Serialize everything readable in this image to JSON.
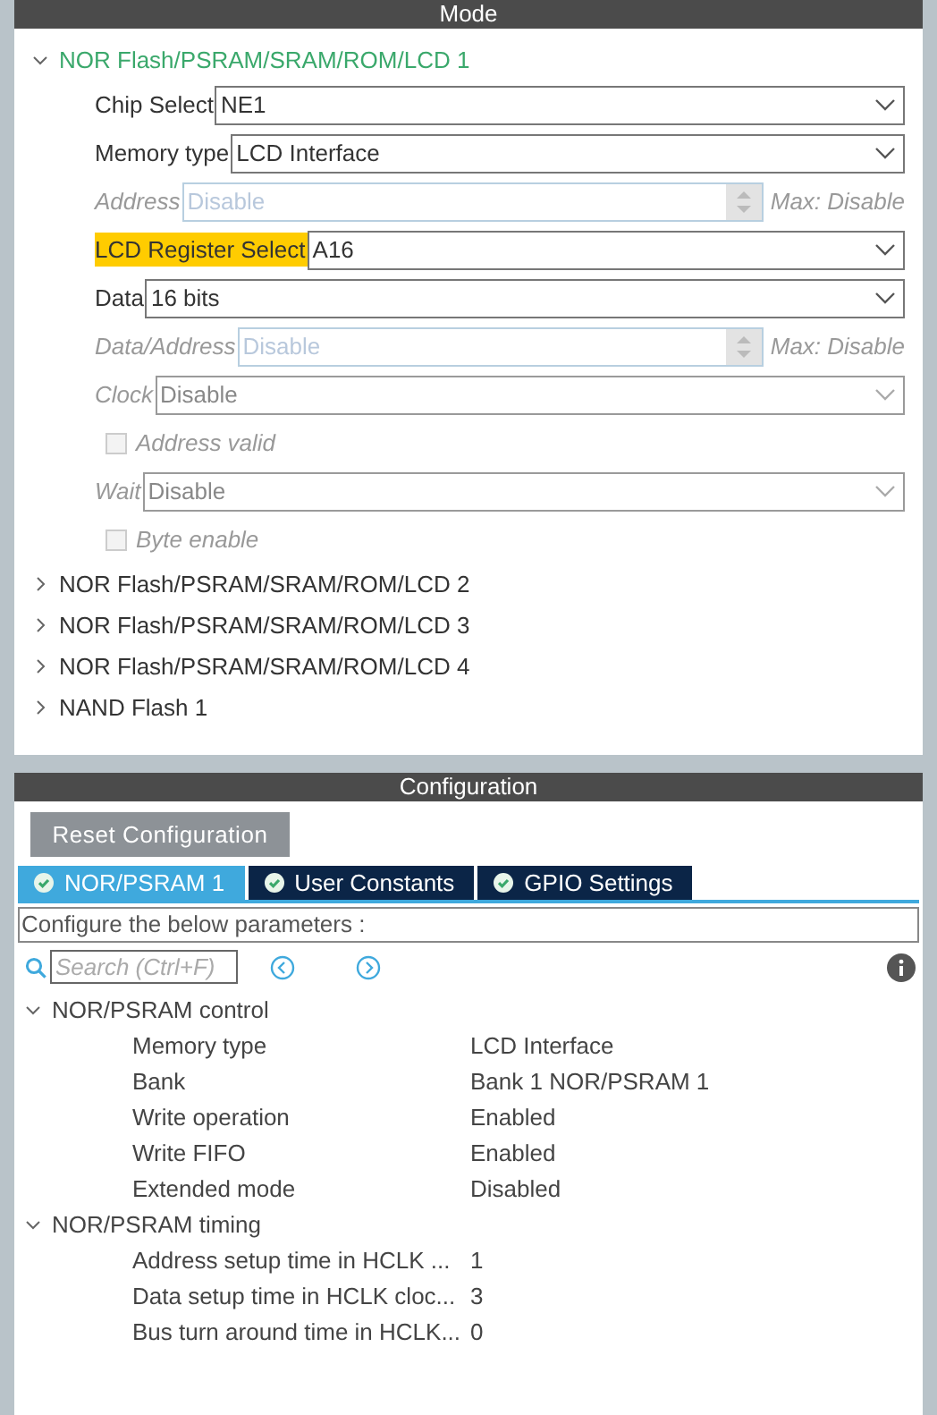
{
  "mode": {
    "title": "Mode",
    "sections": [
      {
        "label": "NOR Flash/PSRAM/SRAM/ROM/LCD 1",
        "expanded": true,
        "active": true,
        "fields": [
          {
            "kind": "select",
            "label": "Chip Select",
            "value": "NE1",
            "disabled": false,
            "highlighted": false
          },
          {
            "kind": "select",
            "label": "Memory type",
            "value": "LCD Interface",
            "disabled": false,
            "highlighted": false
          },
          {
            "kind": "spinner",
            "label": "Address",
            "value": "Disable",
            "max": "Max: Disable",
            "disabled": true,
            "highlighted": false
          },
          {
            "kind": "select",
            "label": "LCD Register Select",
            "value": "A16",
            "disabled": false,
            "highlighted": true
          },
          {
            "kind": "select",
            "label": "Data",
            "value": "16 bits",
            "disabled": false,
            "highlighted": false
          },
          {
            "kind": "spinner",
            "label": "Data/Address",
            "value": "Disable",
            "max": "Max: Disable",
            "disabled": true,
            "highlighted": false
          },
          {
            "kind": "select",
            "label": "Clock",
            "value": "Disable",
            "disabled": true,
            "highlighted": false
          },
          {
            "kind": "checkbox",
            "label": "Address valid",
            "checked": false,
            "disabled": true
          },
          {
            "kind": "select",
            "label": "Wait",
            "value": "Disable",
            "disabled": true,
            "highlighted": false
          },
          {
            "kind": "checkbox",
            "label": "Byte enable",
            "checked": false,
            "disabled": true
          }
        ]
      },
      {
        "label": "NOR Flash/PSRAM/SRAM/ROM/LCD 2",
        "expanded": false,
        "active": false
      },
      {
        "label": "NOR Flash/PSRAM/SRAM/ROM/LCD 3",
        "expanded": false,
        "active": false
      },
      {
        "label": "NOR Flash/PSRAM/SRAM/ROM/LCD 4",
        "expanded": false,
        "active": false
      },
      {
        "label": "NAND Flash 1",
        "expanded": false,
        "active": false
      }
    ]
  },
  "configuration": {
    "title": "Configuration",
    "reset_button": "Reset Configuration",
    "tabs": [
      {
        "label": "NOR/PSRAM 1",
        "selected": true
      },
      {
        "label": "User Constants",
        "selected": false
      },
      {
        "label": "GPIO Settings",
        "selected": false
      }
    ],
    "description": "Configure the below parameters :",
    "search": {
      "placeholder": "Search (Ctrl+F)"
    },
    "groups": [
      {
        "label": "NOR/PSRAM control",
        "expanded": true,
        "params": [
          {
            "name": "Memory type",
            "value": "LCD Interface"
          },
          {
            "name": "Bank",
            "value": "Bank 1 NOR/PSRAM 1"
          },
          {
            "name": "Write operation",
            "value": "Enabled"
          },
          {
            "name": "Write FIFO",
            "value": "Enabled"
          },
          {
            "name": "Extended mode",
            "value": "Disabled"
          }
        ]
      },
      {
        "label": "NOR/PSRAM timing",
        "expanded": true,
        "params": [
          {
            "name": "Address setup time in HCLK ...",
            "value": "1"
          },
          {
            "name": "Data setup time in HCLK cloc...",
            "value": "3"
          },
          {
            "name": "Bus turn around time in HCLK...",
            "value": "0"
          }
        ]
      }
    ]
  }
}
